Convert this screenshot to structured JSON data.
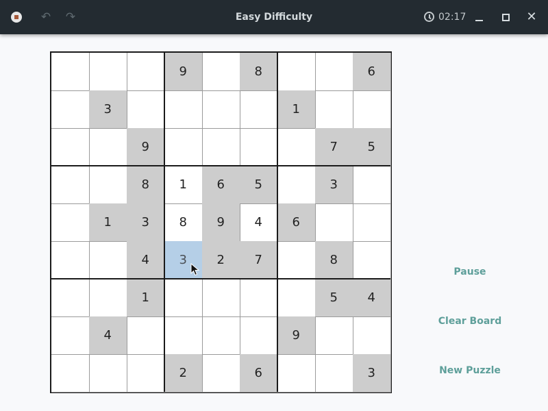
{
  "titlebar": {
    "title": "Easy Difficulty",
    "timer": "02:17",
    "undo_icon": "↶",
    "redo_icon": "↷",
    "close_icon": "✕"
  },
  "board": {
    "selected": [
      5,
      3
    ],
    "rows": [
      [
        0,
        0,
        0,
        9,
        0,
        8,
        0,
        0,
        6
      ],
      [
        0,
        3,
        0,
        0,
        0,
        0,
        1,
        0,
        0
      ],
      [
        0,
        0,
        9,
        0,
        0,
        0,
        0,
        7,
        5
      ],
      [
        0,
        0,
        8,
        1,
        6,
        5,
        0,
        3,
        0
      ],
      [
        0,
        1,
        3,
        8,
        9,
        4,
        6,
        0,
        0
      ],
      [
        0,
        0,
        4,
        3,
        2,
        7,
        0,
        8,
        0
      ],
      [
        0,
        0,
        1,
        0,
        0,
        0,
        0,
        5,
        4
      ],
      [
        0,
        4,
        0,
        0,
        0,
        0,
        9,
        0,
        0
      ],
      [
        0,
        0,
        0,
        2,
        0,
        6,
        0,
        0,
        3
      ]
    ],
    "given": [
      [
        0,
        0,
        0,
        1,
        0,
        1,
        0,
        0,
        1
      ],
      [
        0,
        1,
        0,
        0,
        0,
        0,
        1,
        0,
        0
      ],
      [
        0,
        0,
        1,
        0,
        0,
        0,
        0,
        1,
        1
      ],
      [
        0,
        0,
        1,
        0,
        1,
        1,
        0,
        1,
        0
      ],
      [
        0,
        1,
        1,
        0,
        1,
        0,
        1,
        0,
        0
      ],
      [
        0,
        0,
        1,
        0,
        1,
        1,
        0,
        1,
        0
      ],
      [
        0,
        0,
        1,
        0,
        0,
        0,
        0,
        1,
        1
      ],
      [
        0,
        1,
        0,
        0,
        0,
        0,
        1,
        0,
        0
      ],
      [
        0,
        0,
        0,
        1,
        0,
        1,
        0,
        0,
        1
      ]
    ]
  },
  "actions": {
    "pause": "Pause",
    "clear": "Clear Board",
    "new_puzzle": "New Puzzle"
  },
  "colors": {
    "given_cell": "#cdcdcd",
    "selected_cell": "#b5cfe7",
    "accent": "#5e9f9a",
    "titlebar": "#232b31"
  }
}
